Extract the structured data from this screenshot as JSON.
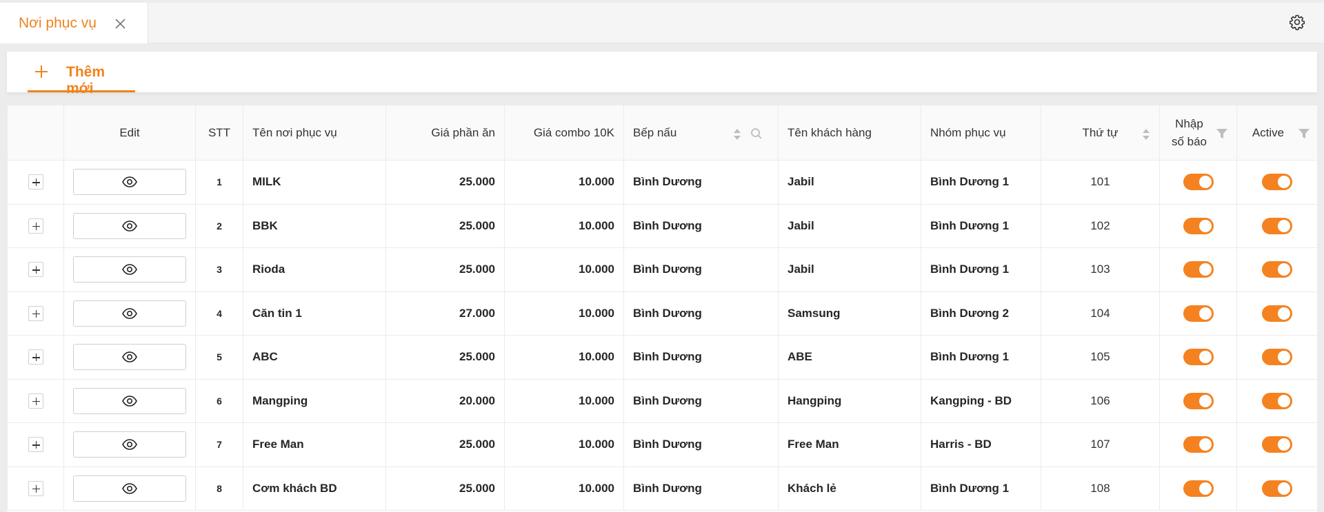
{
  "tab": {
    "label": "Nơi phục vụ"
  },
  "toolbar": {
    "add_label": "Thêm mới"
  },
  "columns": {
    "edit": "Edit",
    "stt": "STT",
    "name": "Tên nơi phục vụ",
    "price": "Giá phần ăn",
    "combo": "Giá combo 10K",
    "kitchen": "Bếp nấu",
    "customer": "Tên khách hàng",
    "group": "Nhóm phục vụ",
    "order": "Thứ tự",
    "report_line1": "Nhập",
    "report_line2": "số báo",
    "active": "Active"
  },
  "rows": [
    {
      "stt": "1",
      "name": "MILK",
      "price": "25.000",
      "combo": "10.000",
      "kitchen": "Bình Dương",
      "customer": "Jabil",
      "group": "Bình Dương 1",
      "order": "101",
      "report_on": true,
      "active_on": true
    },
    {
      "stt": "2",
      "name": "BBK",
      "price": "25.000",
      "combo": "10.000",
      "kitchen": "Bình Dương",
      "customer": "Jabil",
      "group": "Bình Dương 1",
      "order": "102",
      "report_on": true,
      "active_on": true
    },
    {
      "stt": "3",
      "name": "Rioda",
      "price": "25.000",
      "combo": "10.000",
      "kitchen": "Bình Dương",
      "customer": "Jabil",
      "group": "Bình Dương 1",
      "order": "103",
      "report_on": true,
      "active_on": true
    },
    {
      "stt": "4",
      "name": "Căn tin 1",
      "price": "27.000",
      "combo": "10.000",
      "kitchen": "Bình Dương",
      "customer": "Samsung",
      "group": "Bình Dương 2",
      "order": "104",
      "report_on": true,
      "active_on": true
    },
    {
      "stt": "5",
      "name": "ABC",
      "price": "25.000",
      "combo": "10.000",
      "kitchen": "Bình Dương",
      "customer": "ABE",
      "group": "Bình Dương 1",
      "order": "105",
      "report_on": true,
      "active_on": true
    },
    {
      "stt": "6",
      "name": "Mangping",
      "price": "20.000",
      "combo": "10.000",
      "kitchen": "Bình Dương",
      "customer": "Hangping",
      "group": "Kangping - BD",
      "order": "106",
      "report_on": true,
      "active_on": true
    },
    {
      "stt": "7",
      "name": "Free Man",
      "price": "25.000",
      "combo": "10.000",
      "kitchen": "Bình Dương",
      "customer": "Free Man",
      "group": "Harris - BD",
      "order": "107",
      "report_on": true,
      "active_on": true
    },
    {
      "stt": "8",
      "name": "Cơm khách BD",
      "price": "25.000",
      "combo": "10.000",
      "kitchen": "Bình Dương",
      "customer": "Khách lẻ",
      "group": "Bình Dương 1",
      "order": "108",
      "report_on": true,
      "active_on": true
    }
  ],
  "colors": {
    "accent": "#f0821e",
    "toggle_on": "#f58220"
  }
}
